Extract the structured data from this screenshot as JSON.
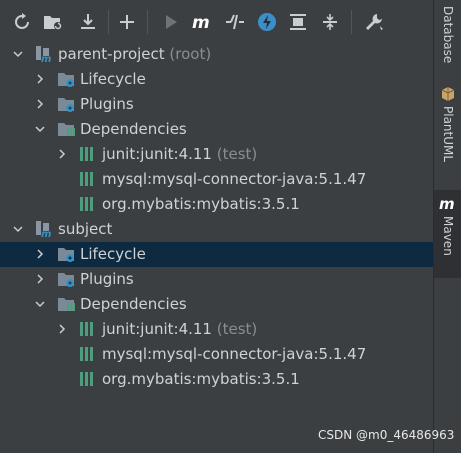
{
  "toolbar": {
    "buttons": [
      {
        "name": "reload-icon"
      },
      {
        "name": "generate-sources-icon"
      },
      {
        "name": "download-icon"
      },
      {
        "name": "add-icon"
      },
      {
        "name": "run-icon"
      },
      {
        "name": "execute-maven-goal-icon"
      },
      {
        "name": "toggle-offline-icon"
      },
      {
        "name": "skip-tests-icon"
      },
      {
        "name": "show-dependencies-icon"
      },
      {
        "name": "collapse-all-icon"
      },
      {
        "name": "settings-icon"
      }
    ]
  },
  "tree": {
    "rows": [
      {
        "label": "parent-project",
        "suffix": "(root)"
      },
      {
        "label": "Lifecycle"
      },
      {
        "label": "Plugins"
      },
      {
        "label": "Dependencies"
      },
      {
        "label": "junit:junit:4.11",
        "suffix": "(test)"
      },
      {
        "label": "mysql:mysql-connector-java:5.1.47"
      },
      {
        "label": "org.mybatis:mybatis:3.5.1"
      },
      {
        "label": "subject"
      },
      {
        "label": "Lifecycle"
      },
      {
        "label": "Plugins"
      },
      {
        "label": "Dependencies"
      },
      {
        "label": "junit:junit:4.11",
        "suffix": "(test)"
      },
      {
        "label": "mysql:mysql-connector-java:5.1.47"
      },
      {
        "label": "org.mybatis:mybatis:3.5.1"
      }
    ]
  },
  "side": {
    "tabs": [
      {
        "label": "Database"
      },
      {
        "label": "PlantUML"
      },
      {
        "label": "Maven",
        "icon": "m"
      }
    ]
  },
  "watermark": "CSDN @m0_46486963",
  "colors": {
    "background": "#3c3f41",
    "selection": "#0d2a40",
    "folder": "#7b8a96",
    "gear": "#3592c4",
    "bars": "#4d9e7e",
    "maven_m": "#ffffff"
  }
}
